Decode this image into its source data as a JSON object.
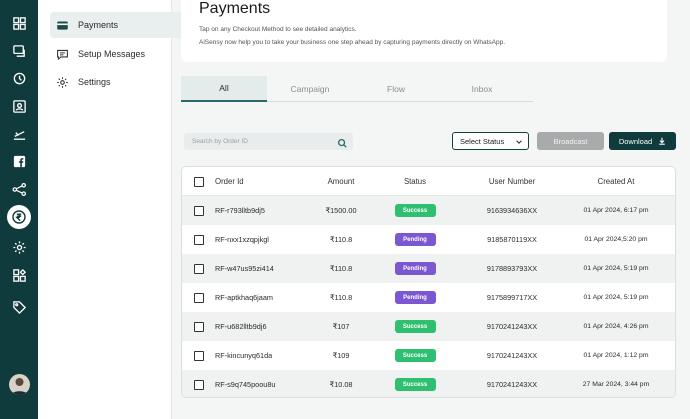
{
  "sidebar": {
    "rail_icons": [
      "dashboard-icon",
      "chat-icon",
      "history-icon",
      "contacts-icon",
      "campaign-icon",
      "facebook-icon",
      "flow-icon",
      "payments-icon",
      "settings-gear-icon",
      "integrations-icon",
      "tag-icon"
    ],
    "active_icon": "payments-icon"
  },
  "menu": {
    "items": [
      {
        "label": "Payments",
        "icon": "card-icon",
        "active": true
      },
      {
        "label": "Setup Messages",
        "icon": "message-icon",
        "active": false
      },
      {
        "label": "Settings",
        "icon": "gear-icon",
        "active": false
      }
    ]
  },
  "header": {
    "title": "Payments",
    "line1": "Tap on any Checkout Method to see detailed analytics.",
    "line2": "AiSensy now help you to take your business one step ahead by capturing payments directly on WhatsApp."
  },
  "tabs": [
    "All",
    "Campaign",
    "Flow",
    "Inbox"
  ],
  "toolbar": {
    "search_placeholder": "Search by Order ID",
    "select_status": "Select Status",
    "broadcast_label": "Broadcast",
    "download_label": "Download"
  },
  "table": {
    "columns": [
      "Order Id",
      "Amount",
      "Status",
      "User Number",
      "Created At"
    ],
    "rows": [
      {
        "order_id": "RF-r793lltb9dj5",
        "amount": "₹1500.00",
        "status": "Success",
        "user_number": "9163934636XX",
        "created_at": "01 Apr 2024, 6:17 pm"
      },
      {
        "order_id": "RF-nxx1xzqpjkgl",
        "amount": "₹110.8",
        "status": "Pending",
        "user_number": "9185870119XX",
        "created_at": "01 Apr 2024,5:20 pm"
      },
      {
        "order_id": "RF-w47us95zi414",
        "amount": "₹110.8",
        "status": "Pending",
        "user_number": "9178893793XX",
        "created_at": "01 Apr 2024, 5:19 pm"
      },
      {
        "order_id": "RF-aptkhaq6jaam",
        "amount": "₹110.8",
        "status": "Pending",
        "user_number": "9175899717XX",
        "created_at": "01 Apr 2024, 5:19 pm"
      },
      {
        "order_id": "RF-u682lltb9dj6",
        "amount": "₹107",
        "status": "Success",
        "user_number": "9170241243XX",
        "created_at": "01 Apr 2024, 4:26 pm"
      },
      {
        "order_id": "RF-kincunyq61da",
        "amount": "₹109",
        "status": "Success",
        "user_number": "9170241243XX",
        "created_at": "01 Apr 2024, 1:12 pm"
      },
      {
        "order_id": "RF-s9q745poou8u",
        "amount": "₹10.08",
        "status": "Success",
        "user_number": "9170241243XX",
        "created_at": "27 Mar 2024, 3:44 pm"
      }
    ]
  },
  "colors": {
    "brand_dark": "#0f3b3c",
    "success": "#2fbf71",
    "pending": "#7b57d1",
    "broadcast_disabled": "#a8abab"
  }
}
